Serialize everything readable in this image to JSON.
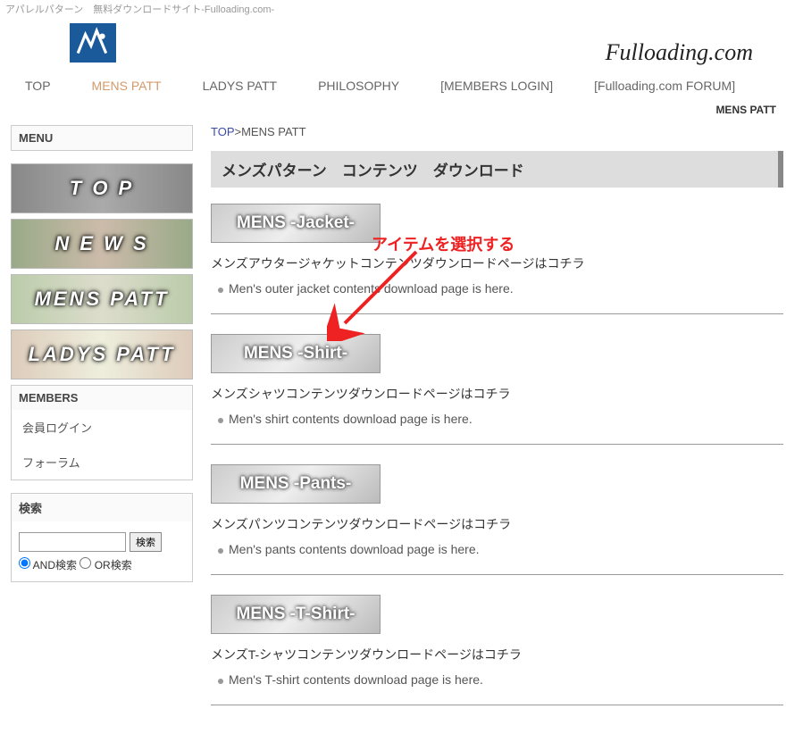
{
  "tagline": "アパレルパターン　無料ダウンロードサイト-Fulloading.com-",
  "brand": "Fulloading.com",
  "nav": {
    "top": "TOP",
    "mens": "MENS PATT",
    "ladys": "LADYS PATT",
    "philosophy": "PHILOSOPHY",
    "members": "[MEMBERS LOGIN]",
    "forum": "[Fulloading.com FORUM]"
  },
  "crumb_right": "MENS PATT",
  "sidebar": {
    "menu_title": "MENU",
    "top_label": "T O P",
    "news_label": "N E W S",
    "mens_label": "MENS PATT",
    "ladys_label": "LADYS PATT",
    "members_title": "MEMBERS",
    "members": [
      "会員ログイン",
      "フォーラム"
    ],
    "search_title": "検索",
    "search_button": "検索",
    "and_label": "AND検索",
    "or_label": "OR検索"
  },
  "breadcrumb": {
    "top": "TOP",
    "sep": ">",
    "current": "MENS PATT"
  },
  "page_title": "メンズパターン　コンテンツ　ダウンロード",
  "annotation": "アイテムを選択する",
  "items": [
    {
      "caption": "MENS -Jacket-",
      "jp": "メンズアウタージャケットコンテンツダウンロードページはコチラ",
      "en": "Men's outer jacket contents download page is here."
    },
    {
      "caption": "MENS -Shirt-",
      "jp": "メンズシャツコンテンツダウンロードページはコチラ",
      "en": "Men's shirt contents download page is here."
    },
    {
      "caption": "MENS -Pants-",
      "jp": "メンズパンツコンテンツダウンロードページはコチラ",
      "en": "Men's pants contents download page is here."
    },
    {
      "caption": "MENS -T-Shirt-",
      "jp": "メンズT-シャツコンテンツダウンロードページはコチラ",
      "en": "Men's T-shirt contents download page is here."
    }
  ]
}
